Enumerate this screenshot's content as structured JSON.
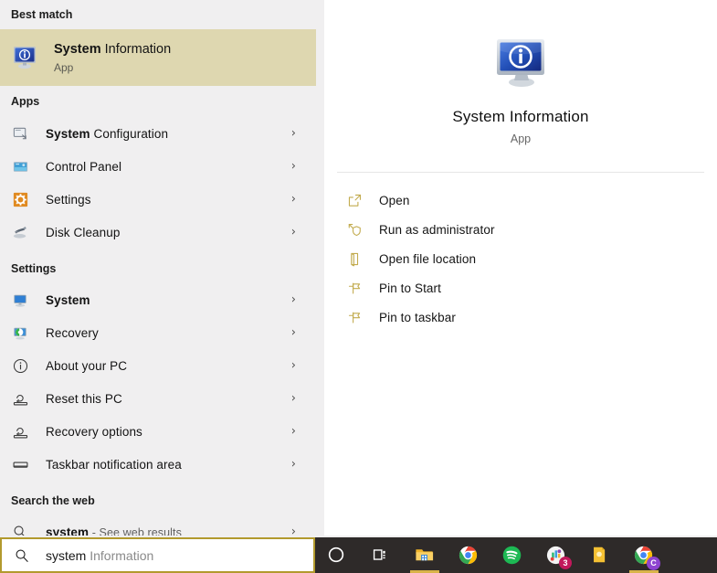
{
  "theme": {
    "left_panel_bg": "#f0eff0",
    "right_panel_bg": "#ffffff",
    "highlight_bg": "#ded7b0",
    "accent_gold": "#b29a2e",
    "taskbar_bg": "#2e2a29",
    "active_underline": "#d9b44a"
  },
  "left": {
    "best_match_header": "Best match",
    "best_match": {
      "title_bold": "System",
      "title_rest": " Information",
      "subtitle": "App",
      "icon": "system-information-icon"
    },
    "apps_header": "Apps",
    "apps": [
      {
        "label_bold": "System",
        "label_rest": " Configuration",
        "icon": "msconfig-icon",
        "chevron": "›"
      },
      {
        "label_bold": "",
        "label_rest": "Control Panel",
        "icon": "control-panel-icon",
        "chevron": "›"
      },
      {
        "label_bold": "",
        "label_rest": "Settings",
        "icon": "settings-gear-icon",
        "chevron": "›"
      },
      {
        "label_bold": "",
        "label_rest": "Disk Cleanup",
        "icon": "disk-cleanup-icon",
        "chevron": "›"
      }
    ],
    "settings_header": "Settings",
    "settings": [
      {
        "label_bold": "System",
        "label_rest": "",
        "icon": "system-monitor-icon",
        "chevron": "›"
      },
      {
        "label_bold": "",
        "label_rest": "Recovery",
        "icon": "recovery-icon",
        "chevron": "›"
      },
      {
        "label_bold": "",
        "label_rest": "About your PC",
        "icon": "info-circle-icon",
        "chevron": "›"
      },
      {
        "label_bold": "",
        "label_rest": "Reset this PC",
        "icon": "reset-pc-icon",
        "chevron": "›"
      },
      {
        "label_bold": "",
        "label_rest": "Recovery options",
        "icon": "reset-pc-icon",
        "chevron": "›"
      },
      {
        "label_bold": "",
        "label_rest": "Taskbar notification area",
        "icon": "taskbar-icon",
        "chevron": "›"
      }
    ],
    "web_header": "Search the web",
    "web": [
      {
        "label_bold": "system",
        "label_dim": " - See web results",
        "icon": "search-icon",
        "chevron": "›"
      }
    ]
  },
  "preview": {
    "icon": "system-information-icon",
    "title": "System Information",
    "subtitle": "App",
    "actions": [
      {
        "label": "Open",
        "icon": "open-icon"
      },
      {
        "label": "Run as administrator",
        "icon": "shield-admin-icon"
      },
      {
        "label": "Open file location",
        "icon": "folder-location-icon"
      },
      {
        "label": "Pin to Start",
        "icon": "pin-icon"
      },
      {
        "label": "Pin to taskbar",
        "icon": "pin-icon"
      }
    ]
  },
  "search": {
    "icon": "search-icon",
    "typed": "system",
    "suggestion": " Information"
  },
  "taskbar": {
    "items": [
      {
        "name": "cortana",
        "icon": "cortana-circle-icon",
        "active": false,
        "badge": ""
      },
      {
        "name": "task-view",
        "icon": "task-view-icon",
        "active": false,
        "badge": ""
      },
      {
        "name": "file-explorer",
        "icon": "file-explorer-icon",
        "active": true,
        "badge": ""
      },
      {
        "name": "chrome",
        "icon": "chrome-icon",
        "active": false,
        "badge": ""
      },
      {
        "name": "spotify",
        "icon": "spotify-icon",
        "active": false,
        "badge": ""
      },
      {
        "name": "notifications-app",
        "icon": "colorful-circle-icon",
        "active": false,
        "badge": "3"
      },
      {
        "name": "sticky-notes",
        "icon": "yellow-note-icon",
        "active": false,
        "badge": ""
      },
      {
        "name": "chrome-profile",
        "icon": "chrome-icon",
        "active": true,
        "badge": "C"
      }
    ]
  }
}
